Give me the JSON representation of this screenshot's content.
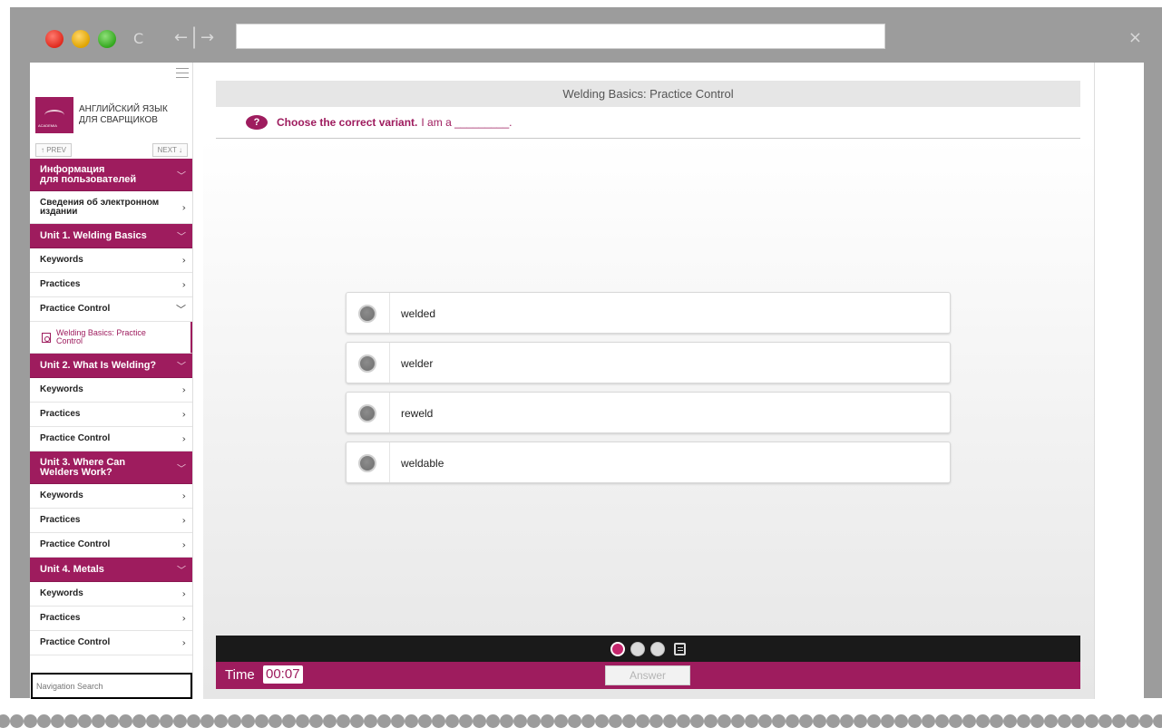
{
  "app": {
    "brand_line1": "АНГЛИЙСКИЙ ЯЗЫК",
    "brand_line2": "ДЛЯ СВАРЩИКОВ",
    "logo_caption": "ACADEMIA"
  },
  "pager": {
    "prev": "↑ PREV",
    "next": "NEXT ↓"
  },
  "nav": [
    {
      "label": "Информация\nдля пользователей",
      "type": "section",
      "arrow": "﹀"
    },
    {
      "label": "Сведения об электронном\nиздании",
      "type": "plain",
      "arrow": "›"
    },
    {
      "label": "Unit 1. Welding Basics",
      "type": "section",
      "arrow": "﹀"
    },
    {
      "label": "Keywords",
      "type": "plain",
      "arrow": "›"
    },
    {
      "label": "Practices",
      "type": "plain",
      "arrow": "›"
    },
    {
      "label": "Practice Control",
      "type": "plain",
      "arrow": "﹀"
    },
    {
      "label": "Welding Basics: Practice\nControl",
      "type": "active",
      "arrow": ""
    },
    {
      "label": "Unit 2. What Is Welding?",
      "type": "section",
      "arrow": "﹀"
    },
    {
      "label": "Keywords",
      "type": "plain",
      "arrow": "›"
    },
    {
      "label": "Practices",
      "type": "plain",
      "arrow": "›"
    },
    {
      "label": "Practice Control",
      "type": "plain",
      "arrow": "›"
    },
    {
      "label": "Unit 3. Where Can\nWelders Work?",
      "type": "section",
      "arrow": "﹀"
    },
    {
      "label": "Keywords",
      "type": "plain",
      "arrow": "›"
    },
    {
      "label": "Practices",
      "type": "plain",
      "arrow": "›"
    },
    {
      "label": "Practice Control",
      "type": "plain",
      "arrow": "›"
    },
    {
      "label": "Unit 4. Metals",
      "type": "section",
      "arrow": "﹀"
    },
    {
      "label": "Keywords",
      "type": "plain",
      "arrow": "›"
    },
    {
      "label": "Practices",
      "type": "plain",
      "arrow": "›"
    },
    {
      "label": "Practice Control",
      "type": "plain",
      "arrow": "›"
    }
  ],
  "search": {
    "placeholder": "Navigation Search"
  },
  "main": {
    "title": "Welding Basics: Practice Control",
    "question_icon": "?",
    "question_bold": "Choose the correct variant.",
    "question_rest": "I am a _________.",
    "options": [
      "welded",
      "welder",
      "reweld",
      "weldable"
    ]
  },
  "footer": {
    "time_label": "Time",
    "time_value": "00:07",
    "answer_label": "Answer"
  },
  "chrome": {
    "reload_glyph": "C",
    "back_glyph": "←",
    "sep_glyph": "|",
    "forward_glyph": "→",
    "close_glyph": "×"
  },
  "colors": {
    "accent": "#9e1c5e",
    "controls_bg": "#1a1a1a",
    "chrome": "#9c9c9c"
  }
}
